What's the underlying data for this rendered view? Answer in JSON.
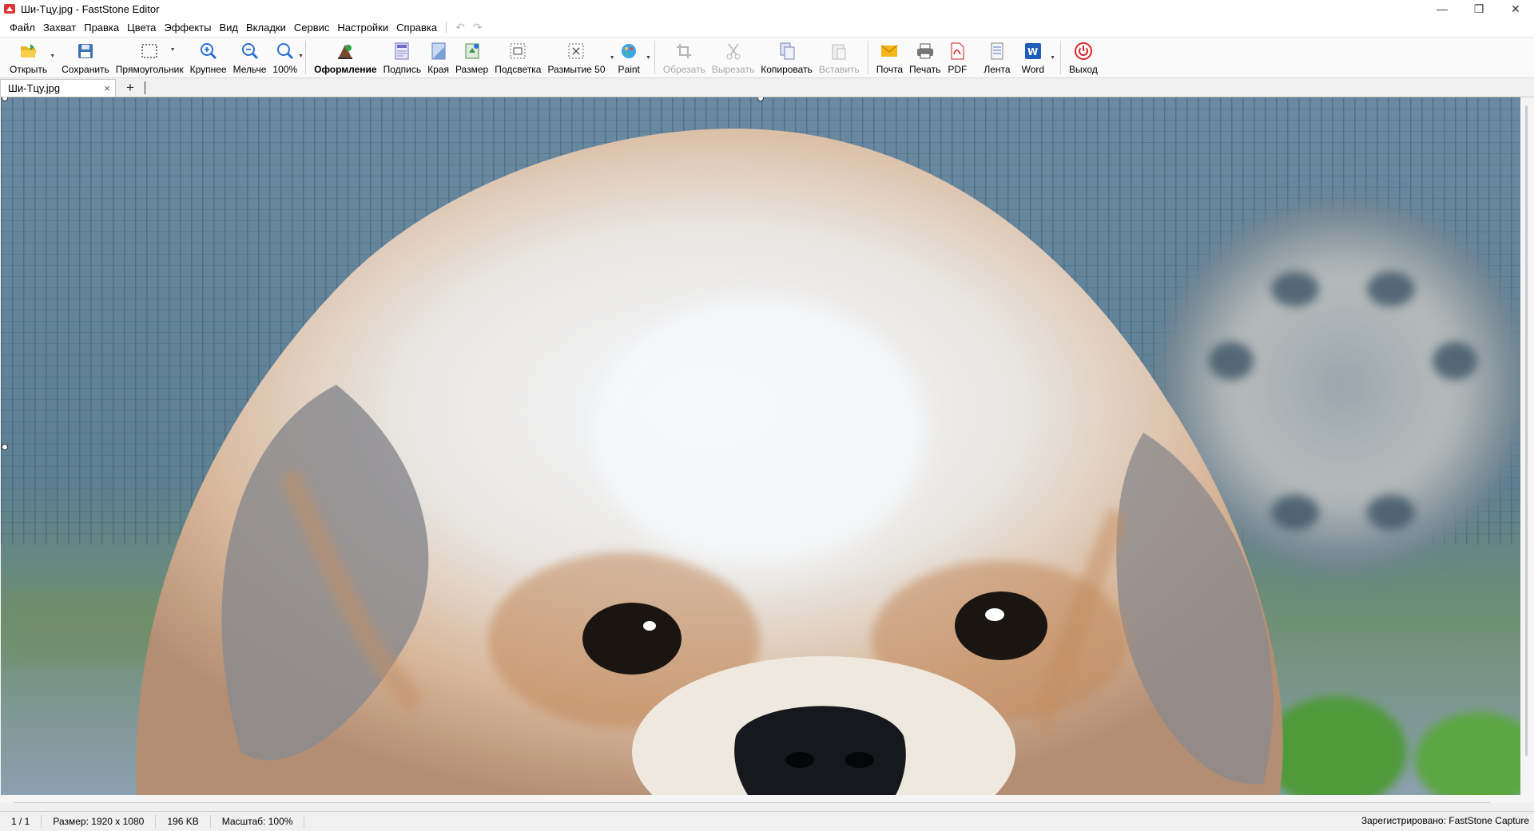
{
  "window": {
    "title": "Ши-Тцу.jpg - FastStone Editor",
    "buttons": [
      "—",
      "❐",
      "✕"
    ]
  },
  "menu": [
    "Файл",
    "Захват",
    "Правка",
    "Цвета",
    "Эффекты",
    "Вид",
    "Вкладки",
    "Сервис",
    "Настройки",
    "Справка"
  ],
  "toolbar": {
    "open": "Открыть",
    "save": "Сохранить",
    "rect": "Прямоугольник",
    "zoom_in": "Крупнее",
    "zoom_out": "Мельче",
    "zoom_100": "100%",
    "decor": "Оформление",
    "caption": "Подпись",
    "edges": "Края",
    "resize": "Размер",
    "spotlight": "Подсветка",
    "blur": "Размытие 50",
    "paint": "Paint",
    "crop": "Обрезать",
    "cut": "Вырезать",
    "copy": "Копировать",
    "paste": "Вставить",
    "mail": "Почта",
    "print": "Печать",
    "pdf": "PDF",
    "tape": "Лента",
    "word": "Word",
    "exit": "Выход"
  },
  "tabs": {
    "active": "Ши-Тцу.jpg",
    "close": "×",
    "add": "+"
  },
  "status": {
    "page": "1 / 1",
    "size": "Размер: 1920 x 1080",
    "filesize": "196 KB",
    "zoom": "Масштаб: 100%",
    "registered": "Зарегистрировано: FastStone Capture"
  },
  "colors": {
    "accent_blue": "#1e6fd9",
    "exit_red": "#d9262b",
    "pdf_red": "#c8231f",
    "mail_yellow": "#f2b51b"
  }
}
